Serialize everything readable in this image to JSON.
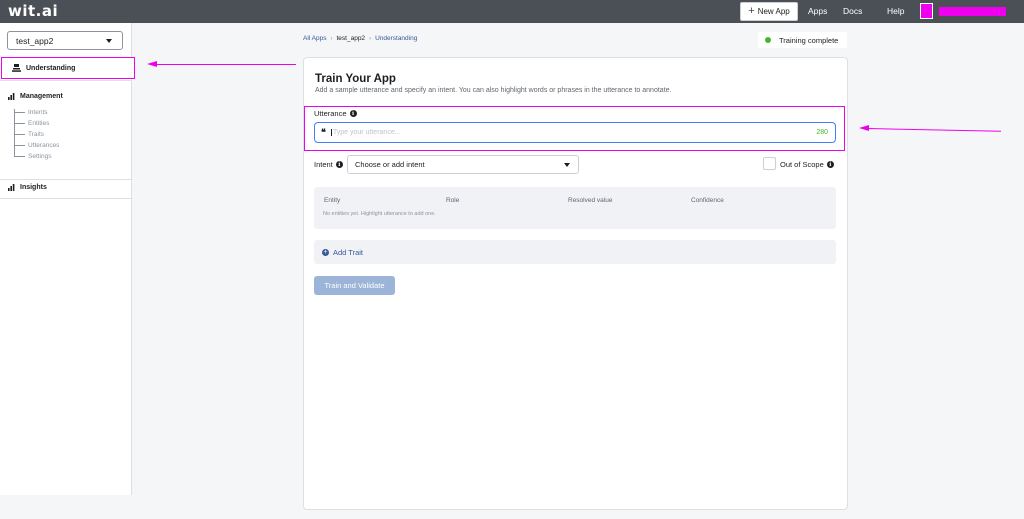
{
  "topbar": {
    "logo": "wit.ai",
    "new_app": "New App",
    "new_app_icon": "plus-icon",
    "links": [
      "Apps",
      "Docs",
      "Help"
    ]
  },
  "sidebar": {
    "app_select": "test_app2",
    "understanding": "Understanding",
    "management": "Management",
    "management_items": [
      "Intents",
      "Entities",
      "Traits",
      "Utterances",
      "Settings"
    ],
    "insights": "Insights"
  },
  "breadcrumb": {
    "all_apps": "All Apps",
    "app": "test_app2",
    "page": "Understanding"
  },
  "training_status": "Training complete",
  "main": {
    "title": "Train Your App",
    "subtitle": "Add a sample utterance and specify an intent. You can also highlight words or phrases in the utterance to annotate.",
    "utterance_label": "Utterance",
    "utterance_placeholder": "Type your utterance...",
    "utterance_count": "280",
    "intent_label": "Intent",
    "intent_select": "Choose or add intent",
    "out_of_scope": "Out of Scope",
    "entity_headers": [
      "Entity",
      "Role",
      "Resolved value",
      "Confidence"
    ],
    "no_entities": "No entities yet. Highlight utterance to add one.",
    "add_trait": "Add Trait",
    "train_button": "Train and Validate"
  },
  "colors": {
    "topbar": "#4b4f56",
    "annotation": "#ee00ee",
    "status_green": "#42b72a",
    "link_blue": "#385898",
    "input_focus": "#4080ff"
  }
}
